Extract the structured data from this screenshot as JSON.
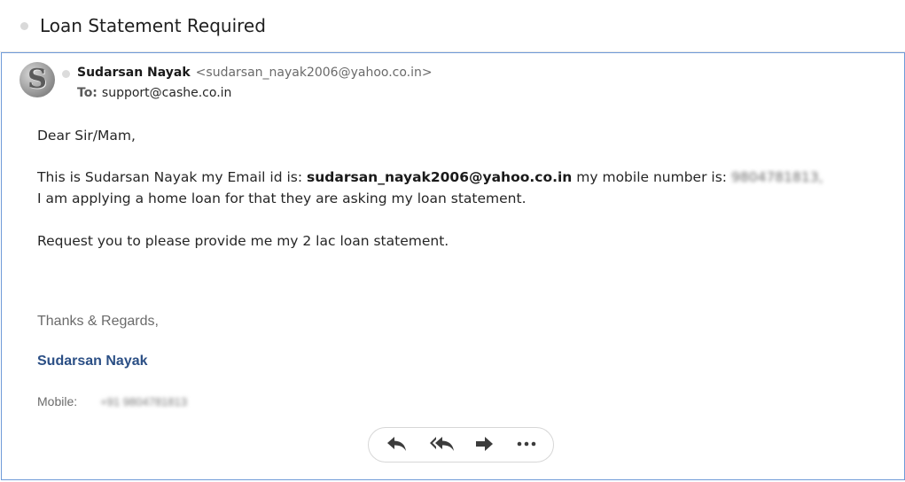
{
  "subject": "Loan Statement Required",
  "sender": {
    "name": "Sudarsan Nayak",
    "email": "<sudarsan_nayak2006@yahoo.co.in>",
    "avatar_letter": "S"
  },
  "recipient": {
    "label": "To:",
    "address": "support@cashe.co.in"
  },
  "body": {
    "greeting": "Dear Sir/Mam,",
    "line1_prefix": "This is Sudarsan Nayak my Email id is: ",
    "line1_email": "sudarsan_nayak2006@yahoo.co.in",
    "line1_suffix": " my mobile number is:",
    "line1_redacted": "9804781813,",
    "line2": "I am applying a home loan for that they are asking my loan statement.",
    "line3": "Request you to please provide me my 2 lac loan statement."
  },
  "signature": {
    "closing": "Thanks & Regards,",
    "name": "Sudarsan Nayak",
    "mobile_label": "Mobile:",
    "mobile_redacted": "+91 9804781813"
  },
  "actions": {
    "reply": "reply-icon",
    "reply_all": "reply-all-icon",
    "forward": "forward-icon",
    "more": "more-icon"
  },
  "colors": {
    "accent_border": "#6f9bd8",
    "signature_name": "#2b4f85"
  }
}
